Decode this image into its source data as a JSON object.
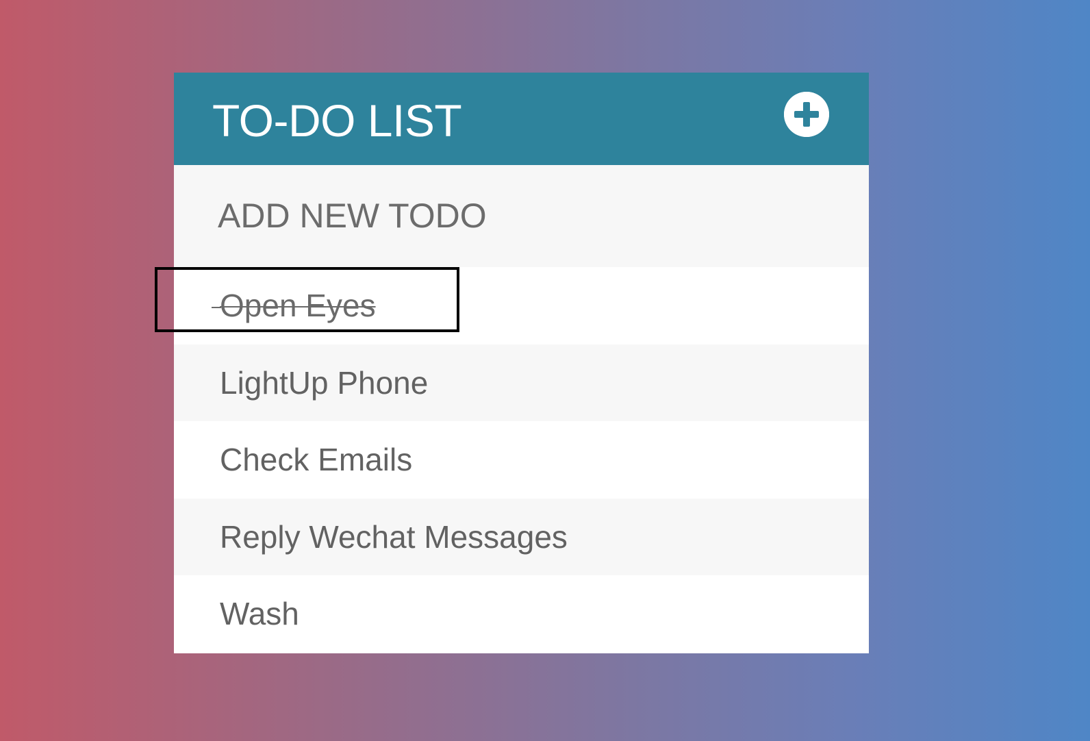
{
  "header": {
    "title": "TO-DO LIST",
    "add_icon": "plus-circle-icon"
  },
  "new_todo": {
    "placeholder": "ADD NEW TODO",
    "value": ""
  },
  "todos": [
    {
      "text": "Open Eyes",
      "completed": true
    },
    {
      "text": "LightUp Phone",
      "completed": false
    },
    {
      "text": "Check Emails",
      "completed": false
    },
    {
      "text": "Reply Wechat Messages",
      "completed": false
    },
    {
      "text": "Wash",
      "completed": false
    }
  ],
  "colors": {
    "header_bg": "#2e839c",
    "text": "#626262",
    "row_alt": "#f7f7f7",
    "highlight_border": "#000000"
  }
}
